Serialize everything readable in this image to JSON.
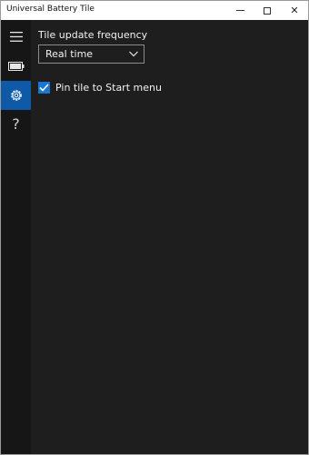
{
  "window": {
    "title": "Universal Battery Tile",
    "controls": {
      "minimize_icon": "minimize-icon",
      "maximize_icon": "maximize-icon",
      "close_icon": "close-icon",
      "close_glyph": "✕"
    }
  },
  "sidebar": {
    "items": [
      {
        "id": "menu",
        "icon": "hamburger-icon",
        "selected": false
      },
      {
        "id": "battery",
        "icon": "battery-icon",
        "selected": false
      },
      {
        "id": "settings",
        "icon": "gear-icon",
        "selected": true
      },
      {
        "id": "help",
        "icon": "question-icon",
        "glyph": "?",
        "selected": false
      }
    ]
  },
  "settings": {
    "tile_update_frequency": {
      "label": "Tile update frequency",
      "selected_value": "Real time"
    },
    "pin_tile": {
      "label": "Pin tile to Start menu",
      "checked": true
    }
  },
  "colors": {
    "accent": "#0e5aa7",
    "checkbox": "#1976d2",
    "background": "#1e1e1e",
    "sidebar": "#161616"
  }
}
